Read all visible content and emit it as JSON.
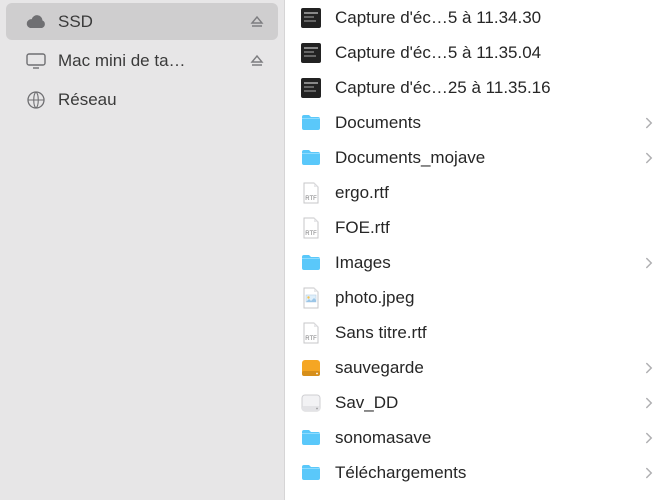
{
  "sidebar": {
    "items": [
      {
        "label": "SSD",
        "icon": "cloud",
        "eject": true,
        "selected": true
      },
      {
        "label": "Mac mini de ta…",
        "icon": "monitor",
        "eject": true,
        "selected": false
      },
      {
        "label": "Réseau",
        "icon": "globe",
        "eject": false,
        "selected": false
      }
    ]
  },
  "main": {
    "items": [
      {
        "name": "Capture d'éc…5 à 11.34.30",
        "kind": "screenshot",
        "folder": false
      },
      {
        "name": "Capture d'éc…5 à 11.35.04",
        "kind": "screenshot",
        "folder": false
      },
      {
        "name": "Capture d'éc…25 à 11.35.16",
        "kind": "screenshot",
        "folder": false
      },
      {
        "name": "Documents",
        "kind": "folder",
        "folder": true
      },
      {
        "name": "Documents_mojave",
        "kind": "folder",
        "folder": true
      },
      {
        "name": "ergo.rtf",
        "kind": "rtf",
        "folder": false
      },
      {
        "name": "FOE.rtf",
        "kind": "rtf",
        "folder": false
      },
      {
        "name": "Images",
        "kind": "folder",
        "folder": true
      },
      {
        "name": "photo.jpeg",
        "kind": "jpeg",
        "folder": false
      },
      {
        "name": "Sans titre.rtf",
        "kind": "rtf",
        "folder": false
      },
      {
        "name": "sauvegarde",
        "kind": "drive-hd",
        "folder": true
      },
      {
        "name": "Sav_DD",
        "kind": "drive-white",
        "folder": true
      },
      {
        "name": "sonomasave",
        "kind": "folder",
        "folder": true
      },
      {
        "name": "Téléchargements",
        "kind": "folder",
        "folder": true
      }
    ]
  },
  "icons": {
    "cloud": "cloud-icon",
    "monitor": "monitor-icon",
    "globe": "globe-icon",
    "folder": "folder-icon",
    "screenshot": "screenshot-icon",
    "rtf": "rtf-icon",
    "jpeg": "jpeg-icon",
    "drive-hd": "drive-hd-icon",
    "drive-white": "drive-white-icon"
  },
  "colors": {
    "folder": "#5ac8fa",
    "driveHd": "#f5a623",
    "driveWhite": "#e8e8ea"
  }
}
